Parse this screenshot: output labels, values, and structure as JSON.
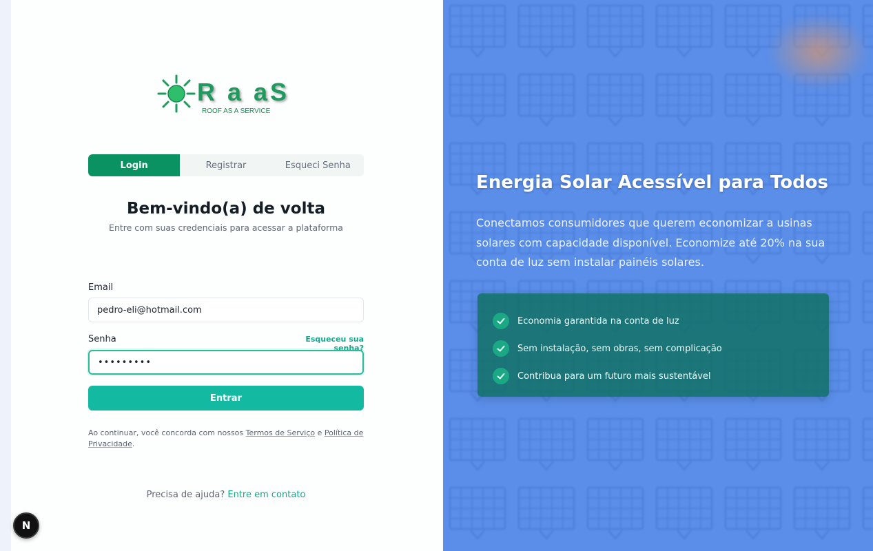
{
  "brand": {
    "name": "R a aS",
    "tagline": "ROOF AS A SERVICE"
  },
  "tabs": [
    {
      "label": "Login",
      "active": true
    },
    {
      "label": "Registrar",
      "active": false
    },
    {
      "label": "Esqueci Senha",
      "active": false
    }
  ],
  "form": {
    "title": "Bem-vindo(a) de volta",
    "subtitle": "Entre com suas credenciais para acessar a plataforma",
    "email_label": "Email",
    "email_value": "pedro-eli@hotmail.com",
    "password_label": "Senha",
    "password_value": "•••••••••",
    "forgot_link": "Esqueceu sua senha?",
    "submit_label": "Entrar"
  },
  "terms": {
    "prefix": "Ao continuar, você concorda com nossos ",
    "tos_link": "Termos de Serviço",
    "and": " e ",
    "privacy_link": "Política de Privacidade",
    "suffix": "."
  },
  "help": {
    "text": "Precisa de ajuda? ",
    "link": "Entre em contato"
  },
  "badge": {
    "letter": "N"
  },
  "hero": {
    "title": "Energia Solar Acessível para Todos",
    "description": "Conectamos consumidores que querem economizar a usinas solares com capacidade disponível. Economize até 20% na sua conta de luz sem instalar painéis solares.",
    "features": [
      "Economia garantida na conta de luz",
      "Sem instalação, sem obras, sem complicação",
      "Contribua para um futuro mais sustentável"
    ]
  },
  "colors": {
    "primary": "#0b9262",
    "accent": "#14b9a1",
    "hero_bg": "#5a8ee9",
    "feature_card": "#0a6e5a"
  }
}
